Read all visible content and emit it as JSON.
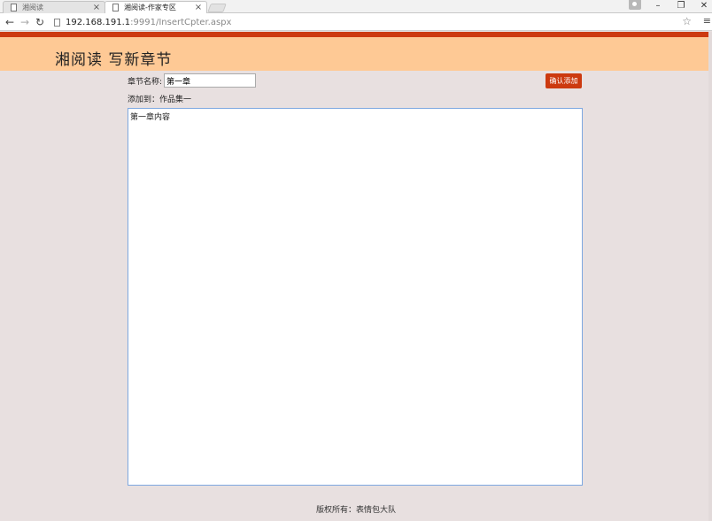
{
  "browser": {
    "tabs": [
      {
        "label": "湘阅读",
        "active": false
      },
      {
        "label": "湘阅读-作家专区",
        "active": true
      }
    ],
    "url_host": "192.168.191.1",
    "url_rest": ":9991/InsertCpter.aspx",
    "icons": {
      "back": "back-arrow-icon",
      "forward": "forward-arrow-icon",
      "reload": "reload-icon",
      "star": "star-icon",
      "menu": "hamburger-menu-icon"
    }
  },
  "page": {
    "banner_title": "湘阅读 写新章节",
    "chapter_name_label": "章节名称:",
    "chapter_name_value": "第一章",
    "confirm_button": "确认添加",
    "add_to_label": "添加到：作品集一",
    "content_value": "第一章内容",
    "footer": "版权所有：表情包大队"
  },
  "colors": {
    "accent": "#cc3a10",
    "banner": "#fec995",
    "background": "#e8e0e0"
  }
}
